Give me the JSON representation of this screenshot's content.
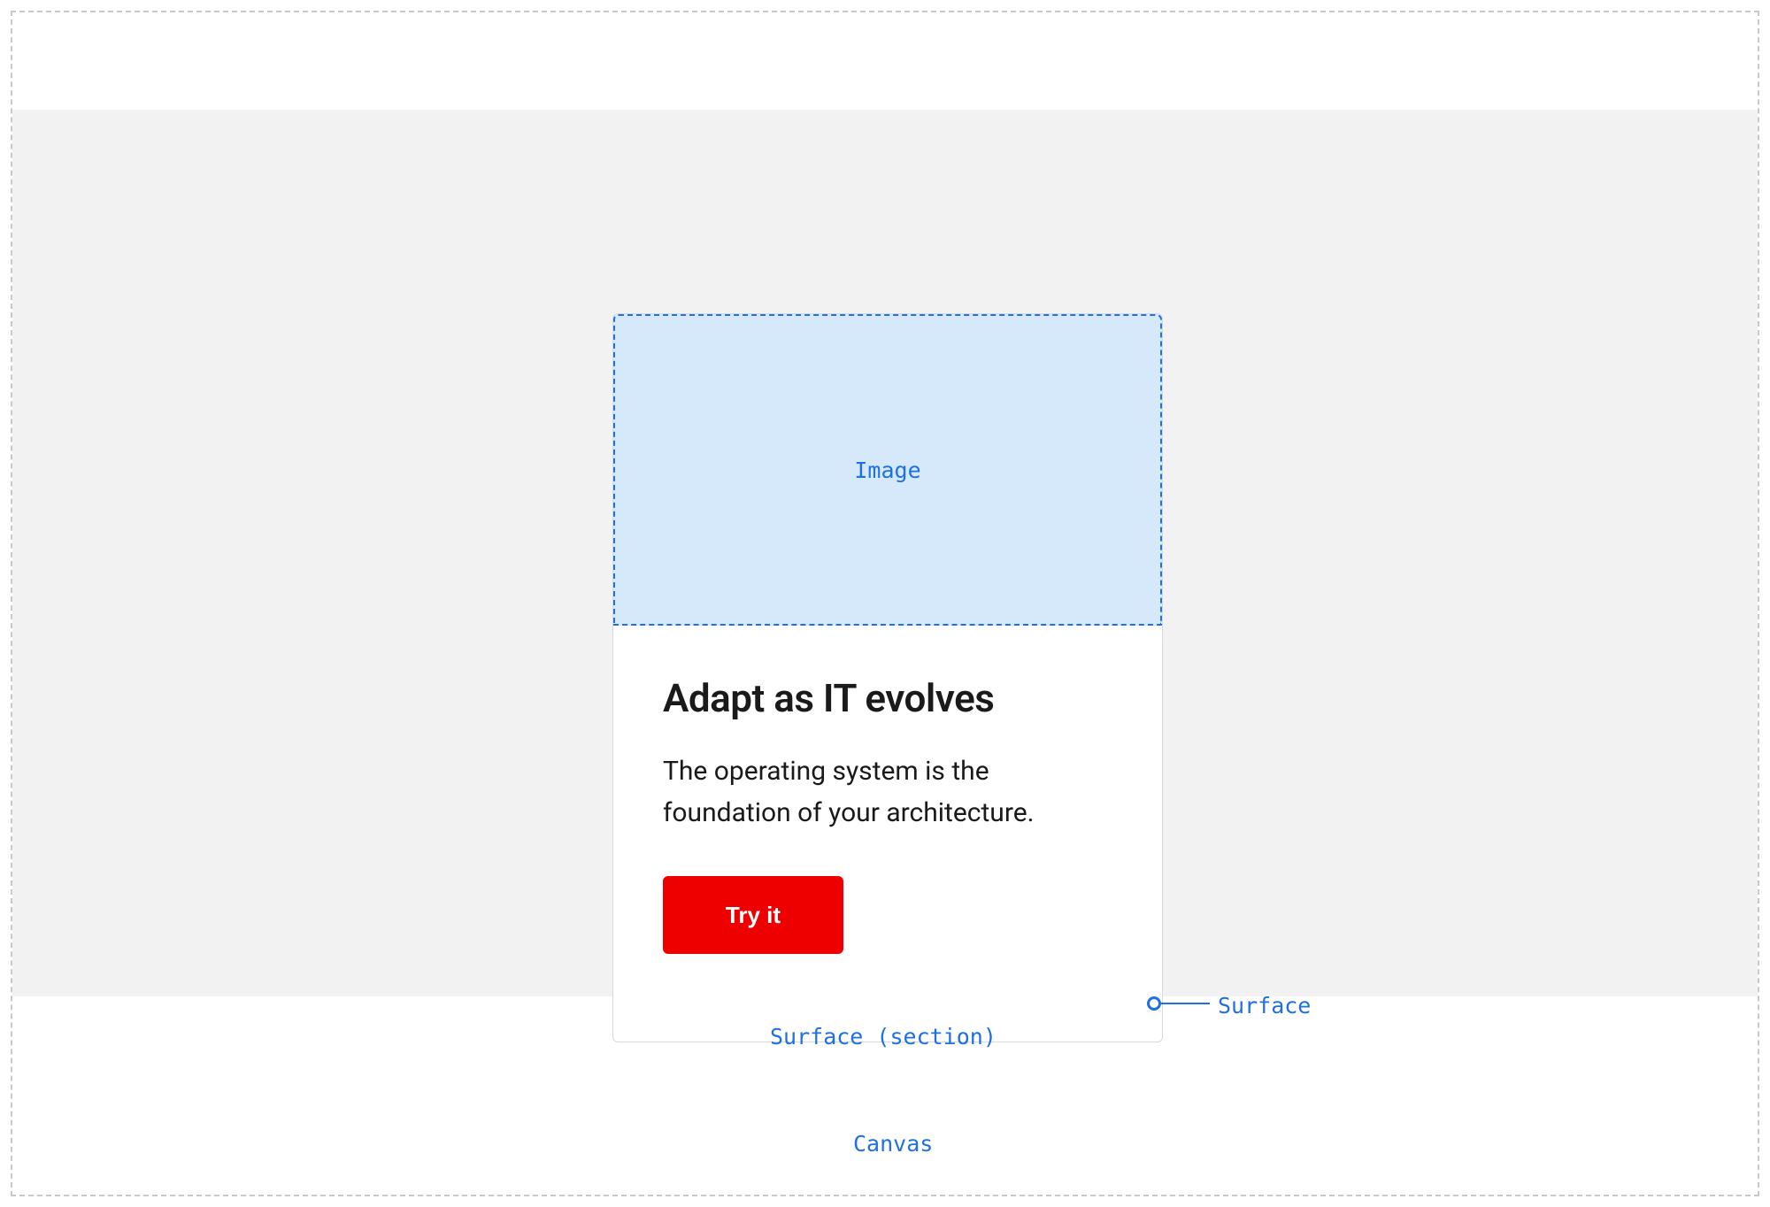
{
  "annotations": {
    "canvas": "Canvas",
    "section": "Surface (section)",
    "surface": "Surface",
    "image_placeholder": "Image"
  },
  "card": {
    "title": "Adapt as IT evolves",
    "description": "The operating system is the foundation of your architecture.",
    "cta_label": "Try it"
  },
  "colors": {
    "accent_blue": "#1f6fe5",
    "placeholder_fill": "#d6e9fb",
    "section_bg": "#f2f2f2",
    "cta_red": "#ee0000"
  }
}
